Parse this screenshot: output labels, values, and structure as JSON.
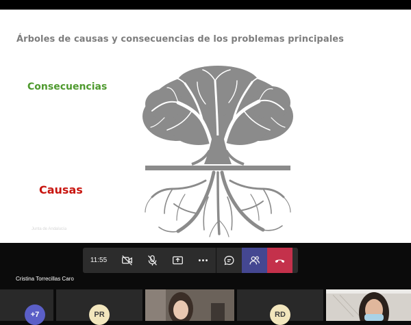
{
  "slide": {
    "title": "Árboles de causas y consecuencias de los problemas principales",
    "label_consequences": "Consecuencias",
    "label_causes": "Causas",
    "credit": "Junta de Andalucía"
  },
  "toolbar": {
    "timer": "11:55",
    "icons": [
      "camera-off-icon",
      "mic-off-icon",
      "share-screen-icon",
      "more-options-icon",
      "chat-icon",
      "participants-icon",
      "hang-up-icon"
    ]
  },
  "presenter": {
    "name": "Cristina Torrecillas Caro"
  },
  "gallery": {
    "overflow_count": "+7",
    "participants": [
      {
        "initials": "PR"
      },
      {
        "initials": "RD"
      }
    ]
  },
  "colors": {
    "consequences": "#4f9a2f",
    "causes": "#c8150f",
    "hangup": "#c4314b",
    "active": "#444791",
    "toolbar": "#2c2c2c"
  }
}
